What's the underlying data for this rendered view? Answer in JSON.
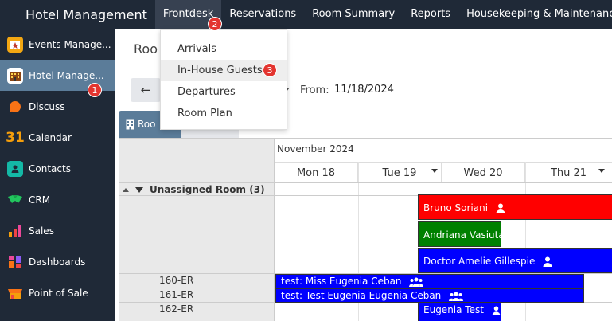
{
  "topbar": {
    "app_title": "Hotel Management",
    "menu": [
      "Frontdesk",
      "Reservations",
      "Room Summary",
      "Reports",
      "Housekeeping & Maintenance"
    ],
    "active": "Frontdesk"
  },
  "sidebar": {
    "items": [
      {
        "label": "Events Manage...",
        "icon": "events-icon",
        "color": "#f3a712"
      },
      {
        "label": "Hotel Manage...",
        "icon": "hotel-icon",
        "color": "#c0392b"
      },
      {
        "label": "Discuss",
        "icon": "discuss-icon",
        "color": "#f97316"
      },
      {
        "label": "Calendar",
        "icon": "calendar-icon",
        "color": "#f59e0b"
      },
      {
        "label": "Contacts",
        "icon": "contacts-icon",
        "color": "#14b8a6"
      },
      {
        "label": "CRM",
        "icon": "crm-icon",
        "color": "#22c55e"
      },
      {
        "label": "Sales",
        "icon": "sales-icon",
        "color": "#ef4444"
      },
      {
        "label": "Dashboards",
        "icon": "dashboards-icon",
        "color": "#ec4899"
      },
      {
        "label": "Point of Sale",
        "icon": "pos-icon",
        "color": "#f97316"
      }
    ],
    "calendar_icon_text": "31"
  },
  "badges": [
    "1",
    "2",
    "3"
  ],
  "content": {
    "page_title": "Roo",
    "back_arrow": "←",
    "from_label": "From:",
    "from_value": "11/18/2024",
    "tab_rooms": "Roo"
  },
  "dropdown": {
    "items": [
      "Arrivals",
      "In-House Guests",
      "Departures",
      "Room Plan"
    ],
    "hovered": "In-House Guests"
  },
  "calendar": {
    "month": "November 2024",
    "days": [
      "Mon 18",
      "Tue 19",
      "Wed 20",
      "Thu 21"
    ],
    "group": "Unassigned Room (3)",
    "rooms": [
      "160-ER",
      "161-ER",
      "162-ER"
    ],
    "events": [
      {
        "label": "Bruno Soriani",
        "color": "#ff0000",
        "icon": "user-icon"
      },
      {
        "label": "Andriana Vasiuta",
        "color": "#008000",
        "icon": ""
      },
      {
        "label": "Doctor Amelie Gillespie",
        "color": "#0000ff",
        "icon": "user-icon"
      },
      {
        "label": "test: Miss Eugenia Ceban",
        "color": "#0000ff",
        "icon": "users-icon"
      },
      {
        "label": "test: Test Eugenia Eugenia Ceban",
        "color": "#0000ff",
        "icon": "users-icon"
      },
      {
        "label": "Eugenia Test",
        "color": "#0000ff",
        "icon": "user-icon"
      }
    ]
  }
}
